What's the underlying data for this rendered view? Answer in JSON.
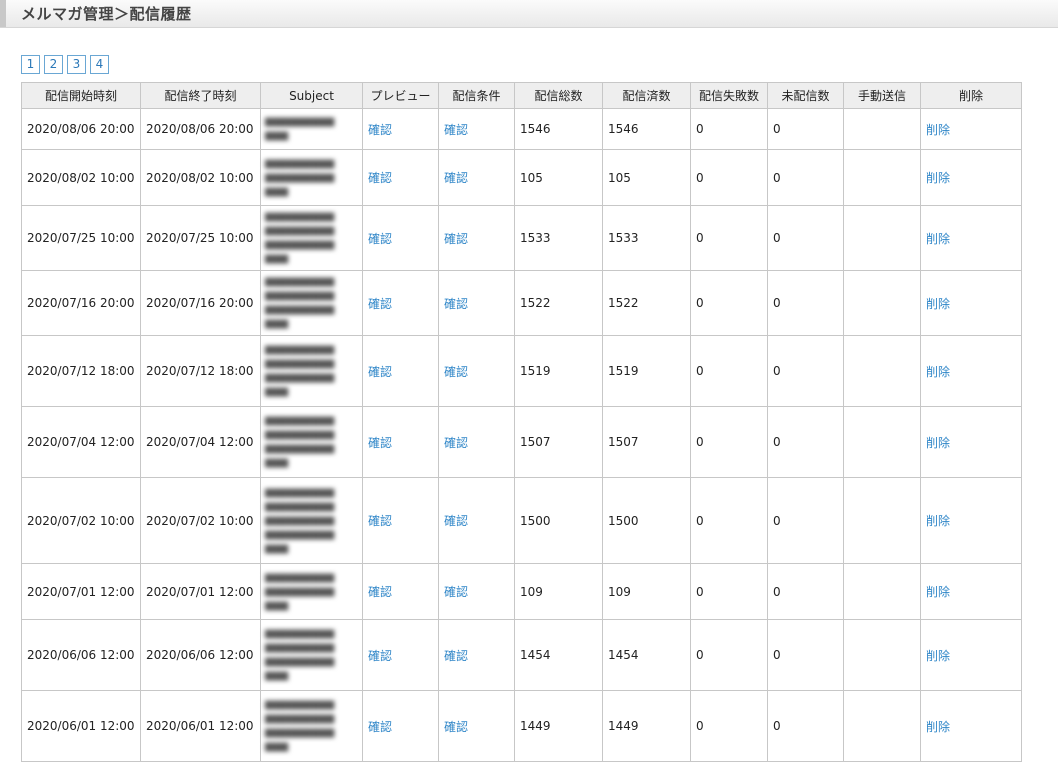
{
  "header": {
    "title": "メルマガ管理＞配信履歴"
  },
  "pager": {
    "pages": [
      "1",
      "2",
      "3",
      "4"
    ]
  },
  "table": {
    "columns": [
      "配信開始時刻",
      "配信終了時刻",
      "Subject",
      "プレビュー",
      "配信条件",
      "配信総数",
      "配信済数",
      "配信失敗数",
      "未配信数",
      "手動送信",
      "削除"
    ],
    "rows": [
      {
        "start": "2020/08/06 20:00",
        "end": "2020/08/06 20:00",
        "subject": "",
        "preview": "確認",
        "condition": "確認",
        "total": "1546",
        "sent": "1546",
        "failed": "0",
        "unsent": "0",
        "manual": "",
        "delete": "削除"
      },
      {
        "start": "2020/08/02 10:00",
        "end": "2020/08/02 10:00",
        "subject": "",
        "preview": "確認",
        "condition": "確認",
        "total": "105",
        "sent": "105",
        "failed": "0",
        "unsent": "0",
        "manual": "",
        "delete": "削除"
      },
      {
        "start": "2020/07/25 10:00",
        "end": "2020/07/25 10:00",
        "subject": "",
        "preview": "確認",
        "condition": "確認",
        "total": "1533",
        "sent": "1533",
        "failed": "0",
        "unsent": "0",
        "manual": "",
        "delete": "削除"
      },
      {
        "start": "2020/07/16 20:00",
        "end": "2020/07/16 20:00",
        "subject": "",
        "preview": "確認",
        "condition": "確認",
        "total": "1522",
        "sent": "1522",
        "failed": "0",
        "unsent": "0",
        "manual": "",
        "delete": "削除"
      },
      {
        "start": "2020/07/12 18:00",
        "end": "2020/07/12 18:00",
        "subject": "",
        "preview": "確認",
        "condition": "確認",
        "total": "1519",
        "sent": "1519",
        "failed": "0",
        "unsent": "0",
        "manual": "",
        "delete": "削除"
      },
      {
        "start": "2020/07/04 12:00",
        "end": "2020/07/04 12:00",
        "subject": "",
        "preview": "確認",
        "condition": "確認",
        "total": "1507",
        "sent": "1507",
        "failed": "0",
        "unsent": "0",
        "manual": "",
        "delete": "削除"
      },
      {
        "start": "2020/07/02 10:00",
        "end": "2020/07/02 10:00",
        "subject": "",
        "preview": "確認",
        "condition": "確認",
        "total": "1500",
        "sent": "1500",
        "failed": "0",
        "unsent": "0",
        "manual": "",
        "delete": "削除"
      },
      {
        "start": "2020/07/01 12:00",
        "end": "2020/07/01 12:00",
        "subject": "",
        "preview": "確認",
        "condition": "確認",
        "total": "109",
        "sent": "109",
        "failed": "0",
        "unsent": "0",
        "manual": "",
        "delete": "削除"
      },
      {
        "start": "2020/06/06 12:00",
        "end": "2020/06/06 12:00",
        "subject": "",
        "preview": "確認",
        "condition": "確認",
        "total": "1454",
        "sent": "1454",
        "failed": "0",
        "unsent": "0",
        "manual": "",
        "delete": "削除"
      },
      {
        "start": "2020/06/01 12:00",
        "end": "2020/06/01 12:00",
        "subject": "",
        "preview": "確認",
        "condition": "確認",
        "total": "1449",
        "sent": "1449",
        "failed": "0",
        "unsent": "0",
        "manual": "",
        "delete": "削除"
      }
    ]
  }
}
